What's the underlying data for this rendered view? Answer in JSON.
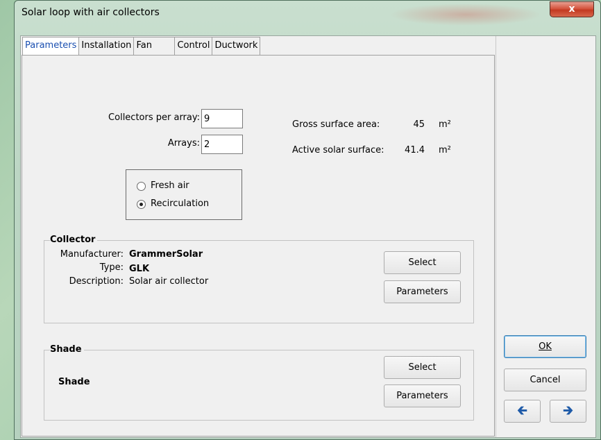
{
  "window": {
    "title": "Solar loop with air collectors",
    "close_label": "x"
  },
  "tabs": [
    "Parameters",
    "Installation",
    "Fan",
    "Control",
    "Ductwork"
  ],
  "parameters": {
    "collectors_per_array_label": "Collectors per array:",
    "collectors_per_array_value": "9",
    "arrays_label": "Arrays:",
    "arrays_value": "2",
    "gross_area_label": "Gross surface area:",
    "gross_area_value": "45",
    "gross_area_unit": "m²",
    "active_surface_label": "Active solar surface:",
    "active_surface_value": "41.4",
    "active_surface_unit": "m²",
    "air_mode": {
      "options": [
        "Fresh air",
        "Recirculation"
      ],
      "selected": "Recirculation"
    }
  },
  "collector": {
    "title": "Collector",
    "manufacturer_label": "Manufacturer:",
    "manufacturer_value": "GrammerSolar",
    "type_label": "Type:",
    "type_value": "GLK",
    "description_label": "Description:",
    "description_value": "Solar air collector",
    "select_label": "Select",
    "parameters_label": "Parameters"
  },
  "shade": {
    "title": "Shade",
    "name": "Shade",
    "select_label": "Select",
    "parameters_label": "Parameters"
  },
  "actions": {
    "ok_label": "OK",
    "cancel_label": "Cancel",
    "back_icon": "arrow-left-icon",
    "forward_icon": "arrow-right-icon"
  }
}
